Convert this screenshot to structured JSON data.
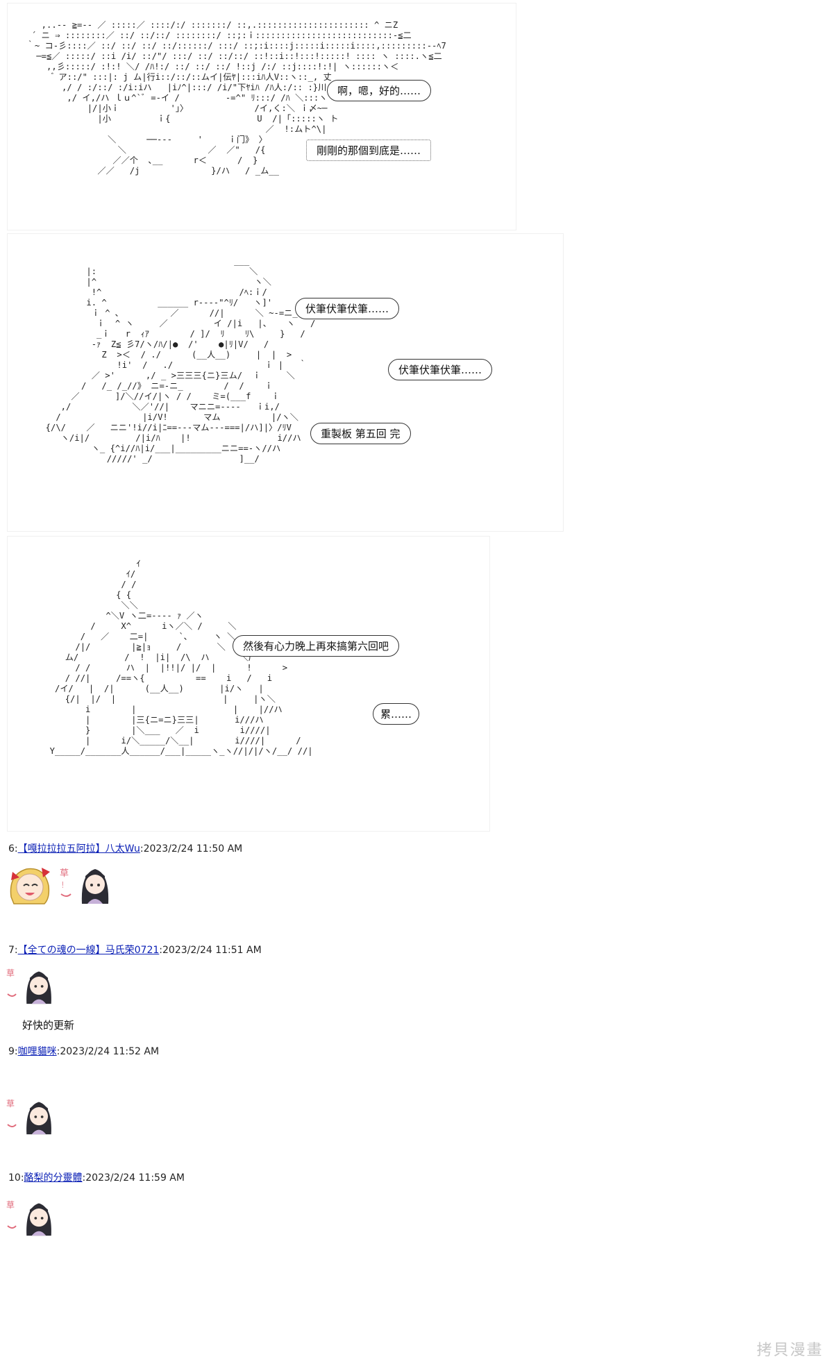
{
  "panels": [
    {
      "ascii": [
        "     ,..-- ≧=-- ／ :::::／ ::::/:/ :::::::/ ::,.:::::::::::::::::::::: ^ ニZ",
        "   ´ ニ ⇒ ::::::::／ ::/ ::/::/ ::::::::/ ::;:ｉ:::::::::::::::::::::::::::-≦二",
        "  ｀~ コ-彡::::／ ::/ ::/ ::/ ::/::::::/ :::/ ::;:i::::j:::::i:::::i::::,:::::::::--ﾍ7",
        "    ─=≦／ :::::/ ::i /i/ ::/\"/ :::/ ::/ ::/::/ ::!::i::!:::!:::::! :::: ヽ ::::.ヽ≦二",
        "      ,,彡:::::/ :!:! ＼/ /ﾊ!:/ ::/ ::/ ::/ !::j /:/ ::j::::!:!| ヽ::::::ヽ＜",
        "        ゙ ア::/\" :::|: j ム|行i::/::/::ムイ|伝ﾔ|:::iﾊ人V::ヽ::_, 丈",
        "         ,/ / :/::/ :/i:iハ   |iﾉ^|:::/ /i/\"下ﾔiﾊ /ﾊ人:/:: :}川::::ヽ ≧=-",
        "          ,/ イ,/ハ ｌｕ^`ﾞ =-イ /         -=^\" ﾘ:::/ /ﾊ ＼:::ヽ",
        "              |/|小ｉ          '」〉             /イ,く:＼ ｉ〆~─",
        "                |小         ｉ{                 U  /|「:::::ヽ ト",
        "                                                 ／  !:ムト^\\|",
        "                  ＼      ──‐‐‐     '     ｉ门》 〉",
        "                    ＼                ／  ／\"   /{",
        "                   ／／个  ､__      r＜      /  }",
        "                ／／   /j              }/ハ   / _ム__"
      ],
      "bubbles": [
        "啊，嗯，好的……",
        "剛剛的那個到底是……"
      ]
    },
    {
      "ascii": [
        "                                       ___",
        "          |:                              ＼",
        "          |^                               ヽ＼",
        "           !^                           /ﾍ:ｉ/",
        "          i. ^          ______ r----\"^ﾘ/   ヽ]'",
        "           ｉ ^ ､          ／      //|      ＼ ~-=ニ_",
        "            ｉ  ^ ヽ     ／         イ /|i   |、   ヽ   /",
        "            _ｉ   r  ｨｱ        / ]/  ﾘ    ﾘ\\     }   /",
        "           -ｧ  Z≦ 彡7/ヽ/ﾊ/|●  /'    ●|ﾘ|V/   /",
        "             Z  >＜  / ./      (__人__)     |  |  >",
        "                !i'  /   ./                  ｉ |   ｀",
        "           ／ >'      ,/ _ >三三三{ニ}三ム/  ｉ     ＼",
        "         /   /_ /_//》 ニ=-ニ_        /  /    ｉ",
        "       ／       ]/＼//イ/|ヽ / /    ミ=(___f    ｉ",
        "     ,/            ＼／'//|    マニニ=----   ｉi,/",
        "    /                |i/V!       マム          |/ヽ＼",
        "  {/\\/    ／   ニニ'!i//i|ﾆ==---マム---===|/ハ]|〉/ﾘV",
        "     ヽ/i|/         /|i/ﾊ    |!                 i//ハ",
        "           ヽ_ {^i//ﾊ|i/___|_________ニニ==-ヽ//ハ",
        "              /////' _/                 ]__/"
      ],
      "bubbles": [
        "伏筆伏筆伏筆……",
        "伏筆伏筆伏筆……",
        "重製板  第五回  完"
      ]
    },
    {
      "ascii": [
        "                      ｲ",
        "                    ｲ/",
        "                   / /",
        "                  { {",
        "                   ＼＼",
        "                ^＼V ヽ二=---- ｧ ／ヽ",
        "             /     X^      iヽ／＼ /     ＼",
        "           /   ／    二=|      `､     ヽ ＼",
        "          /|/        |≧|ｮ     /       ＼  }  ＼",
        "        ム/         /  !  |i|  /\\  ハ      ＼厂 ^",
        "          / /       ハ  |  |!!|/ |/  |      !      >",
        "        / //|     /==ヽ{          ==    i   /   i",
        "      /イ/   |  /|      (__人__)       |i/ヽ   |",
        "        {/|  |/  |                     |     |ヽ＼",
        "            i        |                   |    |//ハ",
        "            |        |三{ニ=ニ}三三|       i///ハ",
        "            }        |＼___   ／  i        i////|",
        "            |      i/＼_____/＼__|        i////|      /",
        "     Y_____/_______人______/___|_____ヽ_ヽ//|/|/ヽ/__/ //|"
      ],
      "bubbles": [
        "然後有心力晚上再來搞第六回吧",
        "累……"
      ]
    }
  ],
  "posts": [
    {
      "num": "6",
      "user": "【嘎拉拉拉五阿拉】八太Wu",
      "time": "2023/2/24 11:50 AM",
      "text": ""
    },
    {
      "num": "7",
      "user": "【全ての魂の一線】马氏荣0721",
      "time": "2023/2/24 11:51 AM",
      "text": "好快的更新"
    },
    {
      "num": "9",
      "user": "咖哩貓咪",
      "time": "2023/2/24 11:52 AM",
      "text": ""
    },
    {
      "num": "10",
      "user": "酪梨的分靈體",
      "time": "2023/2/24 11:59 AM",
      "text": ""
    }
  ],
  "avatar_stamp": "草",
  "watermark": "拷貝漫畫"
}
